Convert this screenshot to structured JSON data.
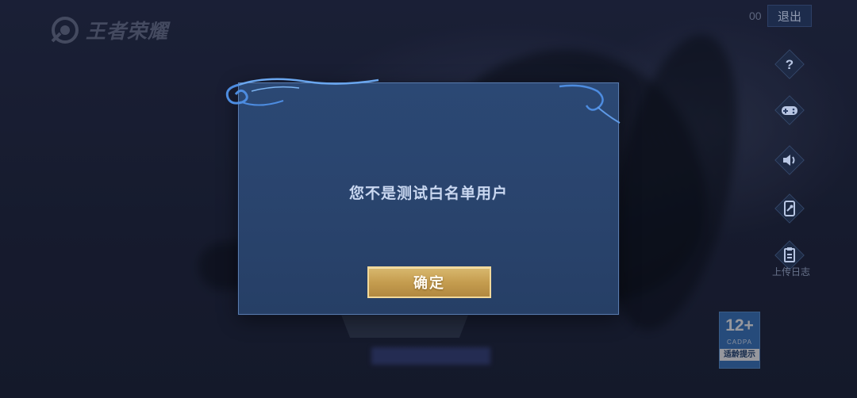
{
  "app": {
    "logo_text": "王者荣耀"
  },
  "header": {
    "counter": "00",
    "exit_label": "退出"
  },
  "side_menu": {
    "items": [
      {
        "icon": "help-icon"
      },
      {
        "icon": "gamepad-icon"
      },
      {
        "icon": "speaker-icon"
      },
      {
        "icon": "phone-repair-icon"
      },
      {
        "icon": "upload-log-icon",
        "label": "上传日志"
      }
    ]
  },
  "age_rating": {
    "age": "12+",
    "org": "CADPA",
    "tip": "适龄提示"
  },
  "dialog": {
    "message": "您不是测试白名单用户",
    "confirm_label": "确定"
  },
  "colors": {
    "background": "#1f2540",
    "dialog_bg": "#29436c",
    "dialog_border": "#5a7cae",
    "button_gold": "#c59d4f",
    "message_text": "#c9d7f0"
  }
}
